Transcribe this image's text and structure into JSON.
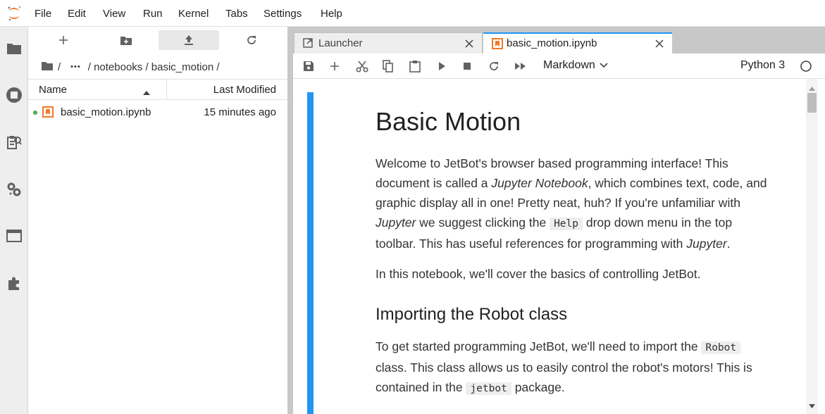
{
  "menu": [
    "File",
    "Edit",
    "View",
    "Run",
    "Kernel",
    "Tabs",
    "Settings",
    "Help"
  ],
  "left_sidebar_icons": [
    "folder-icon",
    "running-icon",
    "commands-icon",
    "property-inspector-icon",
    "tabs-icon",
    "extensions-icon"
  ],
  "file_browser": {
    "toolbar_icons": [
      "new-launcher-icon",
      "new-folder-icon",
      "upload-icon",
      "refresh-icon"
    ],
    "breadcrumb": {
      "root": "/",
      "ellipsis": "•••",
      "path": "/ notebooks / basic_motion /"
    },
    "columns": {
      "name": "Name",
      "modified": "Last Modified"
    },
    "files": [
      {
        "name": "basic_motion.ipynb",
        "modified": "15 minutes ago",
        "running": true
      }
    ]
  },
  "tabs": [
    {
      "label": "Launcher",
      "icon": "launcher-icon",
      "active": false
    },
    {
      "label": "basic_motion.ipynb",
      "icon": "notebook-icon",
      "active": true
    }
  ],
  "notebook_toolbar": {
    "buttons": [
      "save-icon",
      "insert-cell-icon",
      "cut-icon",
      "copy-icon",
      "paste-icon",
      "run-icon",
      "stop-icon",
      "restart-icon",
      "fast-forward-icon"
    ],
    "cell_type": "Markdown",
    "kernel": "Python 3"
  },
  "content": {
    "title": "Basic Motion",
    "p1": {
      "a": "Welcome to JetBot's browser based programming interface! This document is called a ",
      "em1": "Jupyter Notebook",
      "b": ", which combines text, code, and graphic display all in one! Pretty neat, huh? If you're unfamiliar with ",
      "em2": "Jupyter",
      "c": " we suggest clicking the ",
      "code": "Help",
      "d": " drop down menu in the top toolbar. This has useful references for programming with ",
      "em3": "Jupyter",
      "e": "."
    },
    "p2": "In this notebook, we'll cover the basics of controlling JetBot.",
    "h2": "Importing the Robot class",
    "p3": {
      "a": "To get started programming JetBot, we'll need to import the ",
      "code1": "Robot",
      "b": " class. This class allows us to easily control the robot's motors! This is contained in the ",
      "code2": "jetbot",
      "c": " package."
    }
  },
  "colors": {
    "accent": "#2196f3",
    "jupyter_orange": "#f37726",
    "running_dot": "#4caf50"
  }
}
